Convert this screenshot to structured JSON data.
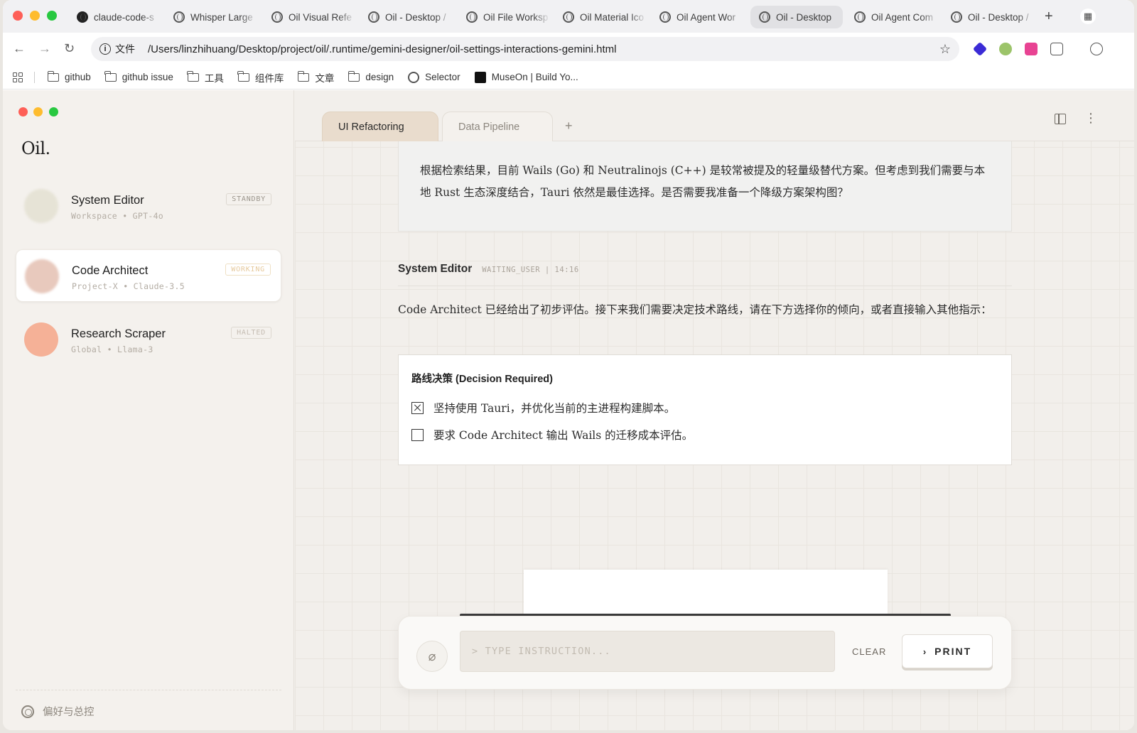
{
  "browser": {
    "tabs": [
      {
        "title": "claude-code-s",
        "icon": "github-icon"
      },
      {
        "title": "Whisper Large",
        "icon": "share-icon"
      },
      {
        "title": "Oil Visual Refe",
        "icon": "globe-icon"
      },
      {
        "title": "Oil - Desktop /",
        "icon": "globe-icon"
      },
      {
        "title": "Oil File Worksp",
        "icon": "globe-icon"
      },
      {
        "title": "Oil Material Ico",
        "icon": "globe-icon"
      },
      {
        "title": "Oil Agent Wor",
        "icon": "globe-icon"
      },
      {
        "title": "Oil - Desktop",
        "icon": "globe-icon",
        "active": true
      },
      {
        "title": "Oil Agent Com",
        "icon": "globe-icon"
      },
      {
        "title": "Oil - Desktop /",
        "icon": "globe-icon"
      }
    ],
    "new_tab": "+",
    "url_scheme": "文件",
    "url": "/Users/linzhihuang/Desktop/project/oil/.runtime/gemini-designer/oil-settings-interactions-gemini.html",
    "bookmarks": [
      "github",
      "github issue",
      "工具",
      "组件库",
      "文章",
      "design",
      "Selector",
      "MuseOn | Build Yo..."
    ]
  },
  "sidebar": {
    "logo": "Oil.",
    "agents": [
      {
        "name": "System Editor",
        "meta": "Workspace • GPT-4o",
        "status": "STANDBY",
        "avatar_color": "#e6e3d6"
      },
      {
        "name": "Code Architect",
        "meta": "Project-X • Claude-3.5",
        "status": "WORKING",
        "avatar_color": "#e8c9bd"
      },
      {
        "name": "Research Scraper",
        "meta": "Global • Llama-3",
        "status": "HALTED",
        "avatar_color": "#f5b197"
      }
    ],
    "prefs_label": "偏好与总控"
  },
  "main": {
    "tabs": [
      {
        "label": "UI Refactoring",
        "active": true
      },
      {
        "label": "Data Pipeline",
        "active": false
      }
    ],
    "add_tab": "+",
    "prev_message": "根据检索结果，目前 Wails (Go) 和 Neutralinojs (C++) 是较常被提及的轻量级替代方案。但考虑到我们需要与本地 Rust 生态深度结合，Tauri 依然是最佳选择。是否需要我准备一个降级方案架构图？",
    "message": {
      "author": "System Editor",
      "status": "WAITING_USER | 14:16",
      "body": "Code Architect 已经给出了初步评估。接下来我们需要决定技术路线，请在下方选择你的倾向，或者直接输入其他指示："
    },
    "decision": {
      "title": "路线决策 (Decision Required)",
      "options": [
        {
          "label": "坚持使用 Tauri，并优化当前的主进程构建脚本。",
          "checked": true
        },
        {
          "label": "要求 Code Architect 输出 Wails 的迁移成本评估。",
          "checked": false
        }
      ]
    },
    "composer": {
      "placeholder": "> TYPE INSTRUCTION...",
      "clear_label": "CLEAR",
      "print_label": "PRINT"
    }
  }
}
